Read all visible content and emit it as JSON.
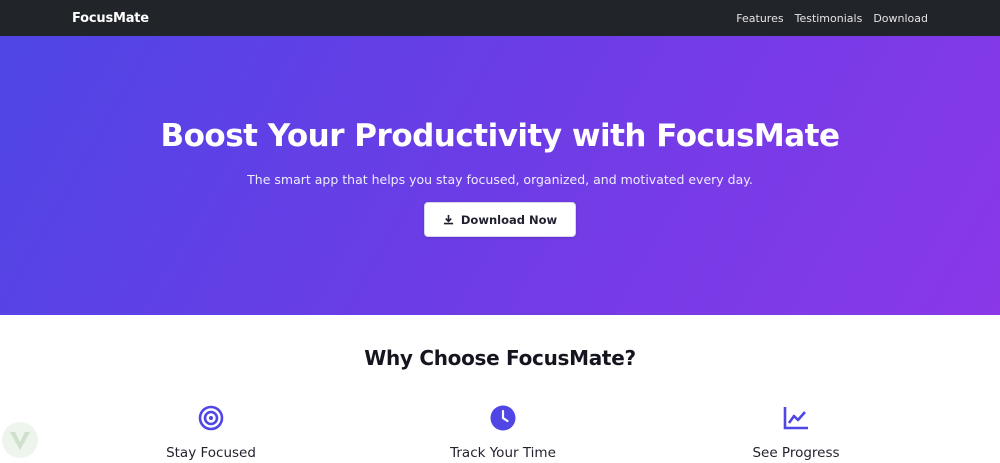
{
  "navbar": {
    "brand": "FocusMate",
    "links": [
      "Features",
      "Testimonials",
      "Download"
    ]
  },
  "hero": {
    "title": "Boost Your Productivity with FocusMate",
    "subtitle": "The smart app that helps you stay focused, organized, and motivated every day.",
    "cta_label": "Download Now",
    "cta_icon": "download-icon"
  },
  "features": {
    "title": "Why Choose FocusMate?",
    "items": [
      {
        "label": "Stay Focused",
        "icon": "target-icon"
      },
      {
        "label": "Track Your Time",
        "icon": "clock-icon"
      },
      {
        "label": "See Progress",
        "icon": "chart-line-icon"
      }
    ]
  },
  "colors": {
    "navbar_bg": "#212529",
    "hero_gradient_start": "#4f46e5",
    "hero_gradient_end": "#8a38e8",
    "icon_accent": "#4f46e5"
  }
}
